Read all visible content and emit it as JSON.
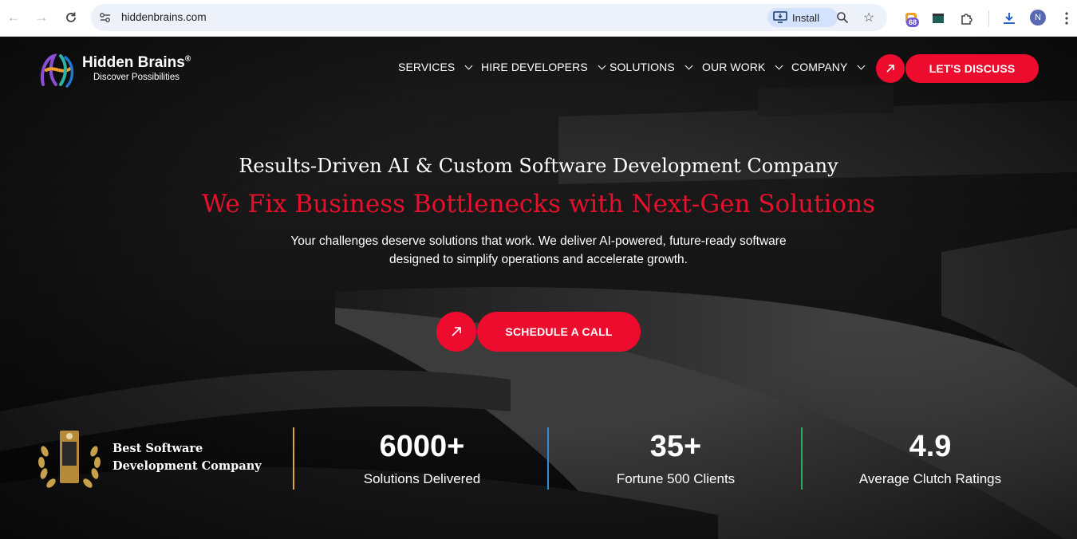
{
  "browser": {
    "url": "hiddenbrains.com",
    "install_label": "Install",
    "extension_badge": "68",
    "profile_initial": "N"
  },
  "site": {
    "logo": {
      "name": "Hidden Brains",
      "reg": "®",
      "tagline": "Discover Possibilities"
    },
    "nav": {
      "services": "SERVICES",
      "hire": "HIRE DEVELOPERS",
      "solutions": "SOLUTIONS",
      "work": "OUR WORK",
      "company": "COMPANY"
    },
    "cta_label": "LET'S DISCUSS"
  },
  "hero": {
    "subtitle": "Results-Driven AI & Custom Software Development Company",
    "title": "We Fix Business Bottlenecks with Next-Gen Solutions",
    "description_line1": "Your challenges deserve solutions that work. We deliver AI-powered, future-ready software",
    "description_line2": "designed to simplify operations and accelerate growth.",
    "schedule_label": "SCHEDULE A CALL"
  },
  "award": {
    "line1": "Best Software",
    "line2": "Development Company"
  },
  "stats": [
    {
      "value": "6000+",
      "label": "Solutions Delivered"
    },
    {
      "value": "35+",
      "label": "Fortune 500 Clients"
    },
    {
      "value": "4.9",
      "label": "Average Clutch Ratings"
    }
  ],
  "colors": {
    "accent": "#ed0b2e",
    "divider1": "#e0a43a",
    "divider2": "#2a8fd8",
    "divider3": "#2fa860"
  }
}
